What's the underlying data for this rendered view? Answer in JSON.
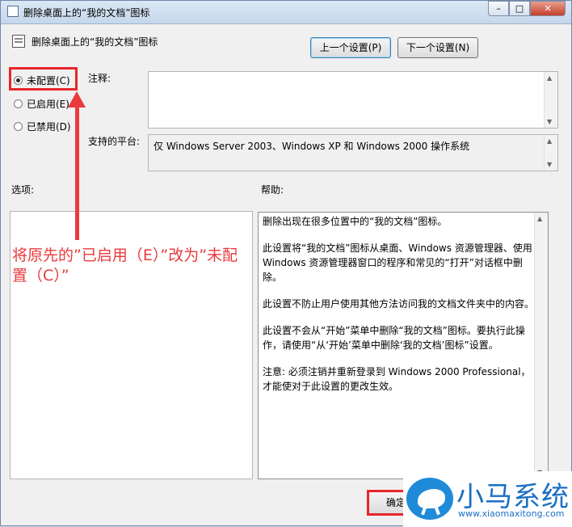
{
  "window": {
    "title": "删除桌面上的“我的文档”图标",
    "controls": {
      "minimize": "–",
      "maximize": "□",
      "close": "✕"
    }
  },
  "header": {
    "policy_name": "删除桌面上的“我的文档”图标"
  },
  "nav": {
    "prev_label": "上一个设置(P)",
    "next_label": "下一个设置(N)"
  },
  "options": {
    "not_configured": "未配置(C)",
    "enabled": "已启用(E)",
    "disabled": "已禁用(D)",
    "selected": "not_configured"
  },
  "comment": {
    "label": "注释:",
    "value": ""
  },
  "platform": {
    "label": "支持的平台:",
    "value": "仅 Windows Server 2003、Windows XP 和 Windows 2000 操作系统"
  },
  "sections": {
    "options_label": "选项:",
    "help_label": "帮助:"
  },
  "help": {
    "paragraphs": [
      "删除出现在很多位置中的“我的文档”图标。",
      "此设置将“我的文档”图标从桌面、Windows 资源管理器、使用 Windows 资源管理器窗口的程序和常见的“打开”对话框中删除。",
      "此设置不防止用户使用其他方法访问我的文档文件夹中的内容。",
      "此设置不会从“开始”菜单中删除“我的文档”图标。要执行此操作，请使用“从‘开始’菜单中删除‘我的文档’图标”设置。",
      "注意: 必须注销并重新登录到 Windows 2000 Professional，才能使对于此设置的更改生效。"
    ]
  },
  "annotation": {
    "text": "将原先的”已启用（E）”改为”未配置（C）”",
    "color": "#ea3a3c"
  },
  "footer": {
    "ok_label": "确定"
  },
  "watermark": {
    "brand": "小马系统",
    "url": "www.xiaomaxitong.com"
  }
}
